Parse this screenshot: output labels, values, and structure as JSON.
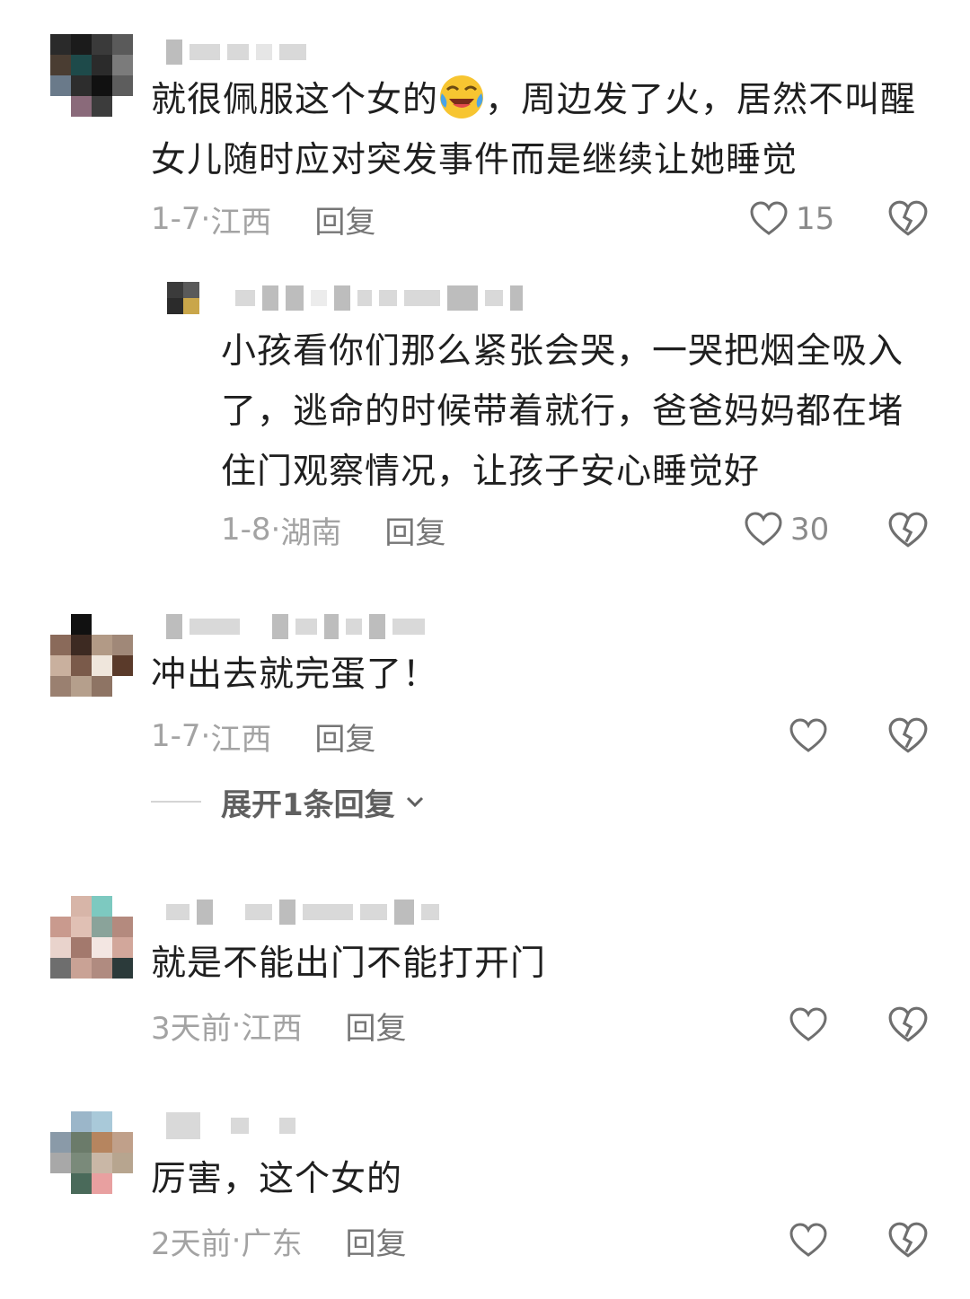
{
  "comments": [
    {
      "text_before_emoji": "就很佩服这个女的",
      "emoji": "crying-laughing-emoji",
      "text_after_emoji": "，周边发了火，居然不叫醒女儿随时应对突发事件而是继续让她睡觉",
      "date": "1-7",
      "location": "江西",
      "reply_label": "回复",
      "likes": "15"
    },
    {
      "text": "小孩看你们那么紧张会哭，一哭把烟全吸入了，逃命的时候带着就行，爸爸妈妈都在堵住门观察情况，让孩子安心睡觉好",
      "date": "1-8",
      "location": "湖南",
      "reply_label": "回复",
      "likes": "30"
    },
    {
      "text": "冲出去就完蛋了！",
      "date": "1-7",
      "location": "江西",
      "reply_label": "回复",
      "expand_label": "展开1条回复"
    },
    {
      "text": "就是不能出门不能打开门",
      "date": "3天前",
      "location": "江西",
      "reply_label": "回复"
    },
    {
      "text": "厉害，这个女的",
      "date": "2天前",
      "location": "广东",
      "reply_label": "回复"
    }
  ],
  "icons": {
    "like": "heart-outline-icon",
    "dislike": "broken-heart-icon",
    "expand": "chevron-down-icon"
  }
}
